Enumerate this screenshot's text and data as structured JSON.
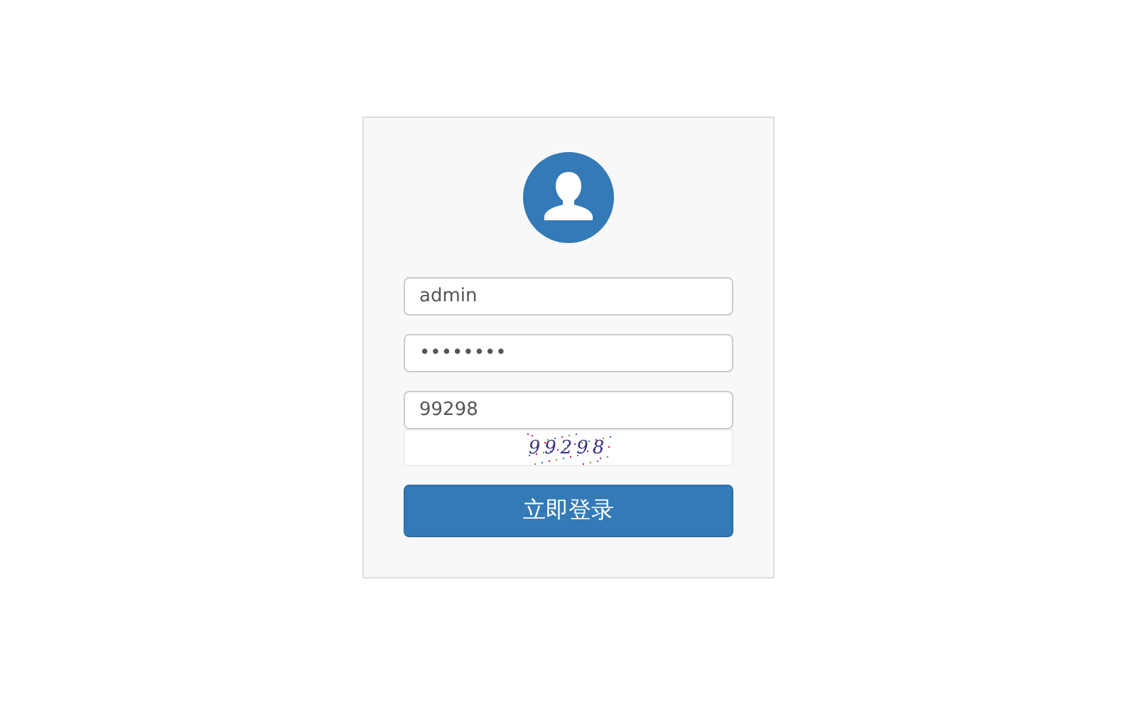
{
  "login_form": {
    "username": {
      "value": "admin"
    },
    "password": {
      "value": "••••••••"
    },
    "captcha_field": {
      "value": "99298"
    },
    "captcha_image": {
      "text": "99298"
    },
    "submit_button": {
      "label": "立即登录"
    }
  }
}
